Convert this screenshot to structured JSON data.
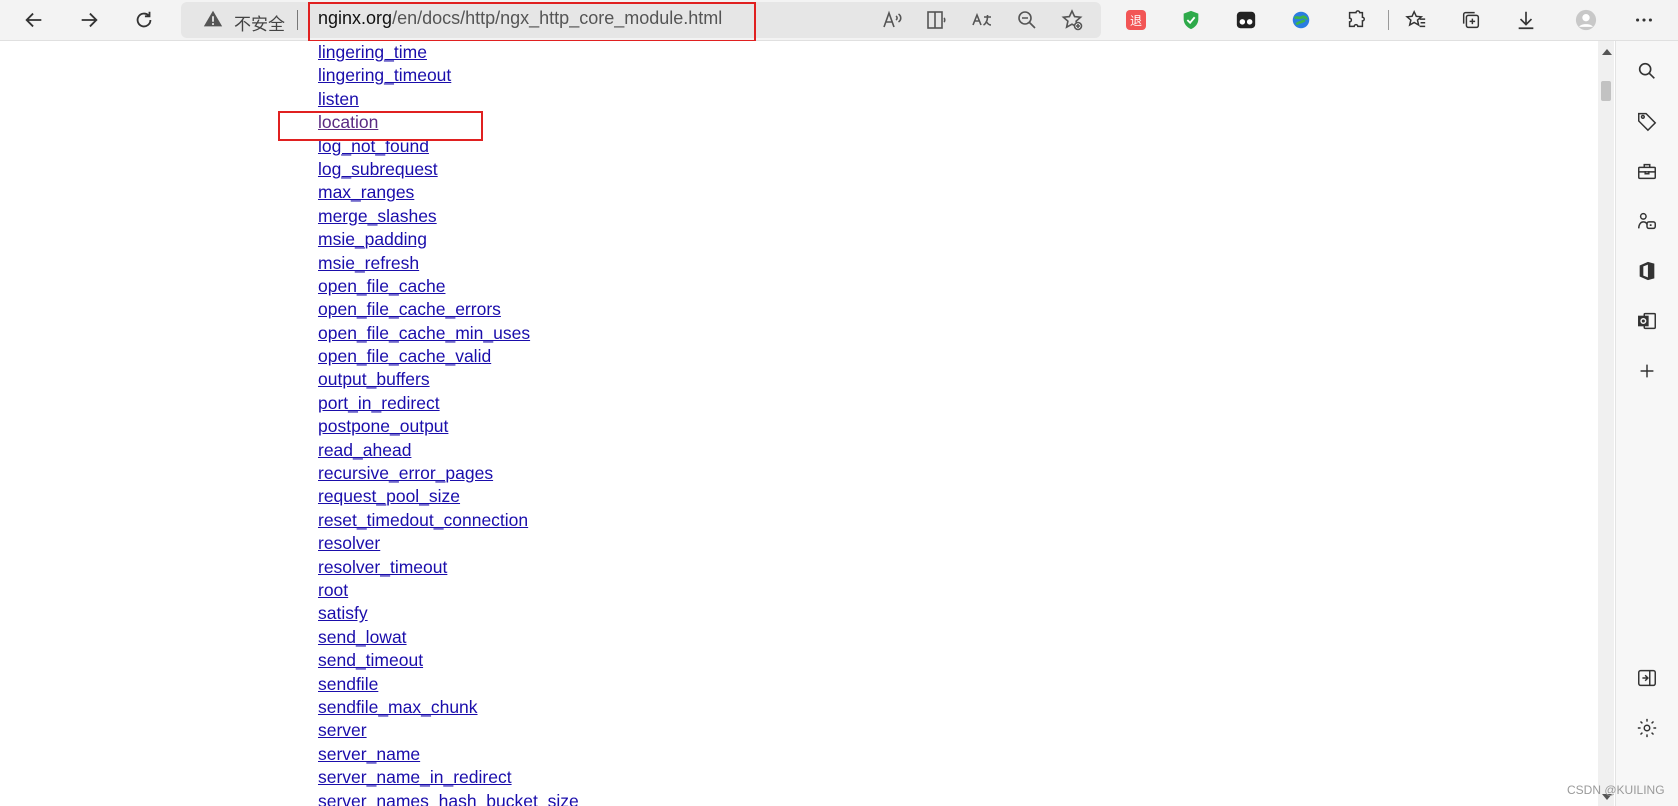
{
  "toolbar": {
    "insecure_label": "不安全",
    "url_host": "nginx.org",
    "url_path": "/en/docs/http/ngx_http_core_module.html",
    "extension_badge": "退"
  },
  "directives": [
    "lingering_time",
    "lingering_timeout",
    "listen",
    "location",
    "log_not_found",
    "log_subrequest",
    "max_ranges",
    "merge_slashes",
    "msie_padding",
    "msie_refresh",
    "open_file_cache",
    "open_file_cache_errors",
    "open_file_cache_min_uses",
    "open_file_cache_valid",
    "output_buffers",
    "port_in_redirect",
    "postpone_output",
    "read_ahead",
    "recursive_error_pages",
    "request_pool_size",
    "reset_timedout_connection",
    "resolver",
    "resolver_timeout",
    "root",
    "satisfy",
    "send_lowat",
    "send_timeout",
    "sendfile",
    "sendfile_max_chunk",
    "server",
    "server_name",
    "server_name_in_redirect",
    "server_names_hash_bucket_size"
  ],
  "highlighted_directive": "location",
  "watermark": "CSDN @KUILING",
  "colors": {
    "link": "#1a0dab",
    "visited_link": "#5a2a82",
    "highlight_box": "#e02020"
  },
  "icons": {
    "back": "back-arrow-icon",
    "forward": "forward-arrow-icon",
    "refresh": "refresh-icon",
    "warning": "warning-icon",
    "read_aloud": "read-aloud-icon",
    "immersive_reader": "immersive-reader-icon",
    "translate": "translate-icon",
    "zoom": "zoom-out-icon",
    "favorite_add": "add-favorite-icon",
    "extensions": "puzzle-icon",
    "favorites": "favorites-icon",
    "collections": "collections-icon",
    "downloads": "download-icon",
    "profile": "profile-icon",
    "more": "more-icon"
  }
}
